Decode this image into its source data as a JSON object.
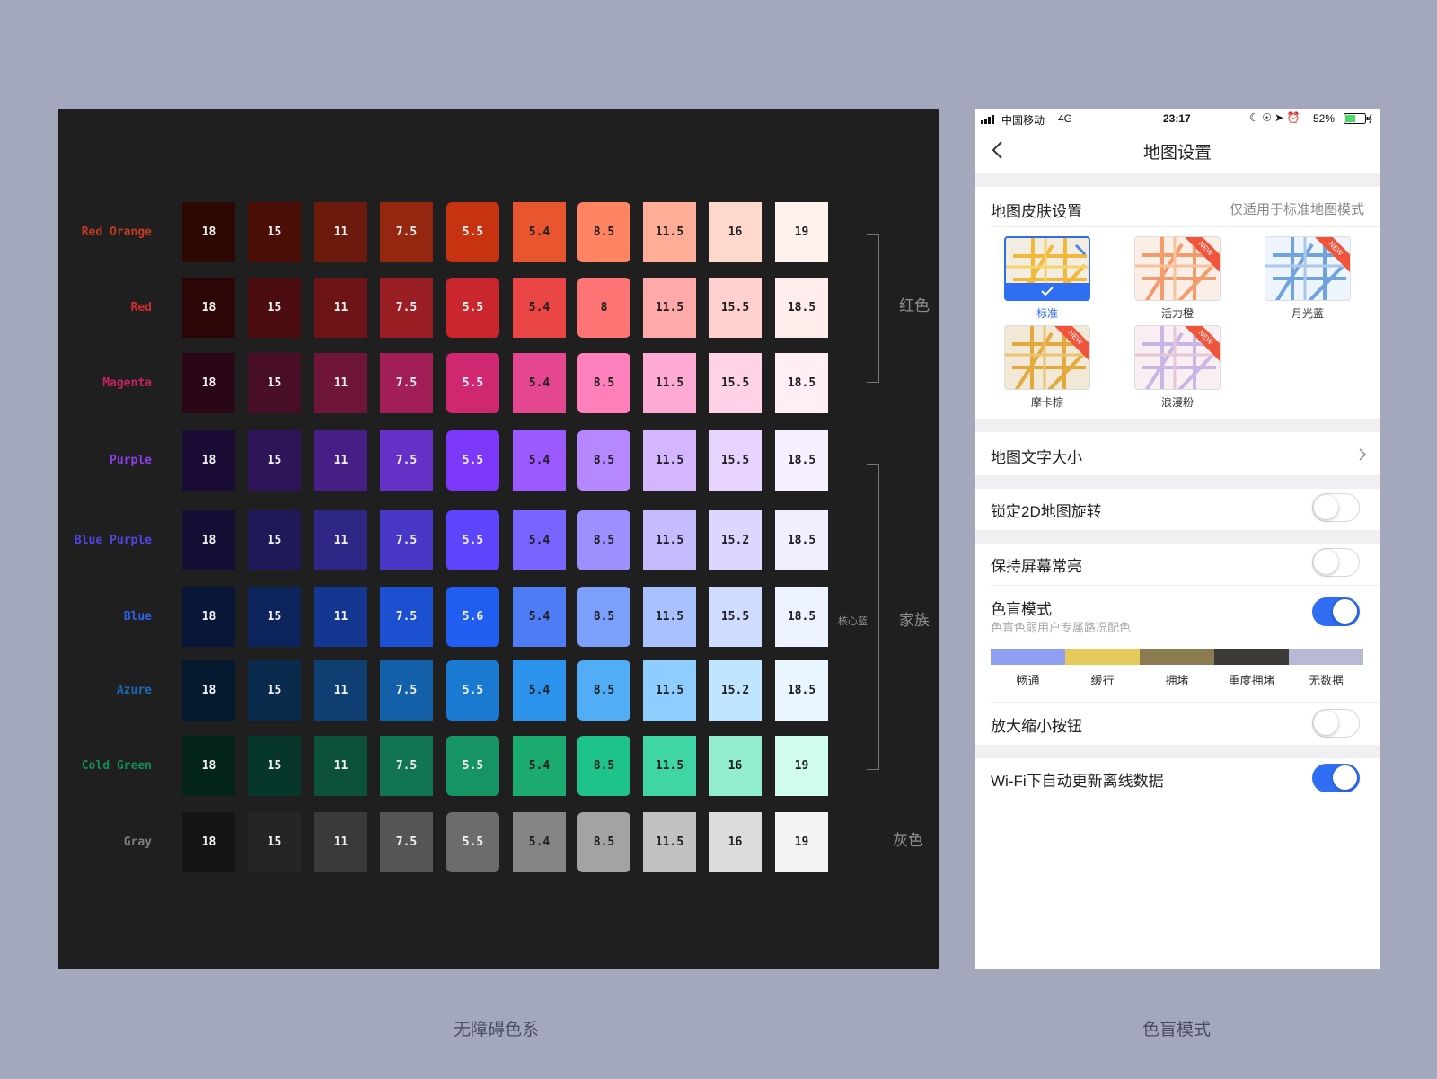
{
  "palette": {
    "rows": [
      {
        "name": "Red Orange",
        "label_color": "#c53a22",
        "values": [
          "18",
          "15",
          "11",
          "7.5",
          "5.5",
          "5.4",
          "8.5",
          "11.5",
          "16",
          "19"
        ],
        "colors": [
          "#2d0803",
          "#4a0f06",
          "#6b1a0c",
          "#95260f",
          "#c73211",
          "#e8552f",
          "#ff8463",
          "#ffad96",
          "#ffd8cd",
          "#fff1ec"
        ]
      },
      {
        "name": "Red",
        "label_color": "#d42b31",
        "values": [
          "18",
          "15",
          "11",
          "7.5",
          "5.5",
          "5.4",
          "8",
          "11.5",
          "15.5",
          "18.5"
        ],
        "colors": [
          "#2d0707",
          "#4b0d0f",
          "#6d1417",
          "#9a1f24",
          "#c9262e",
          "#ea4646",
          "#ff7474",
          "#ffaaa8",
          "#ffd0cd",
          "#ffeceb"
        ]
      },
      {
        "name": "Magenta",
        "label_color": "#c2225e",
        "values": [
          "18",
          "15",
          "11",
          "7.5",
          "5.5",
          "5.4",
          "8.5",
          "11.5",
          "15.5",
          "18.5"
        ],
        "colors": [
          "#2a0716",
          "#480d27",
          "#6e1539",
          "#a11f56",
          "#cf2871",
          "#e44790",
          "#ff80bb",
          "#ffaad5",
          "#ffd2e8",
          "#ffeef6"
        ]
      },
      {
        "name": "Purple",
        "label_color": "#8a3ee8",
        "values": [
          "18",
          "15",
          "11",
          "7.5",
          "5.5",
          "5.4",
          "8.5",
          "11.5",
          "15.5",
          "18.5"
        ],
        "colors": [
          "#1b0c35",
          "#2d1558",
          "#451f85",
          "#6530c6",
          "#7b38f8",
          "#9b59ff",
          "#b588ff",
          "#d4b5ff",
          "#e6d4ff",
          "#f6efff"
        ]
      },
      {
        "name": "Blue Purple",
        "label_color": "#5645e6",
        "values": [
          "18",
          "15",
          "11",
          "7.5",
          "5.5",
          "5.4",
          "8.5",
          "11.5",
          "15.2",
          "18.5"
        ],
        "colors": [
          "#130f35",
          "#1f1958",
          "#2f2785",
          "#4938c8",
          "#5d45fb",
          "#7864ff",
          "#9d8fff",
          "#c4bcff",
          "#ddd7ff",
          "#f1eeff"
        ]
      },
      {
        "name": "Blue",
        "label_color": "#2f5fe6",
        "values": [
          "18",
          "15",
          "11",
          "7.5",
          "5.6",
          "5.4",
          "8.5",
          "11.5",
          "15.5",
          "18.5"
        ],
        "colors": [
          "#081638",
          "#0d235c",
          "#143590",
          "#1d4fd1",
          "#1f5ef0",
          "#4d7cf5",
          "#7c9ffb",
          "#a9c1ff",
          "#cfdcff",
          "#ecf2ff"
        ]
      },
      {
        "name": "Azure",
        "label_color": "#1b69b8",
        "values": [
          "18",
          "15",
          "11",
          "7.5",
          "5.5",
          "5.4",
          "8.5",
          "11.5",
          "15.2",
          "18.5"
        ],
        "colors": [
          "#051a2e",
          "#0a2a4c",
          "#0f3f72",
          "#1460a8",
          "#1a79d1",
          "#2b93ec",
          "#51adf6",
          "#8dceff",
          "#c0e5ff",
          "#e9f6ff"
        ]
      },
      {
        "name": "Cold Green",
        "label_color": "#148a58",
        "values": [
          "18",
          "15",
          "11",
          "7.5",
          "5.5",
          "5.4",
          "8.5",
          "11.5",
          "16",
          "19"
        ],
        "colors": [
          "#04231a",
          "#07372a",
          "#0c5239",
          "#127551",
          "#169463",
          "#1cab70",
          "#1dc389",
          "#40d5a5",
          "#92ecd0",
          "#d0fcee"
        ]
      },
      {
        "name": "Gray",
        "label_color": "#7d7d7d",
        "values": [
          "18",
          "15",
          "11",
          "7.5",
          "5.5",
          "5.4",
          "8.5",
          "11.5",
          "16",
          "19"
        ],
        "colors": [
          "#151515",
          "#252525",
          "#3a3a3a",
          "#555555",
          "#6c6c6c",
          "#858585",
          "#a3a3a3",
          "#c2c2c2",
          "#dcdcdc",
          "#f3f3f3"
        ]
      }
    ],
    "groups": {
      "red": "红色",
      "family": "家族",
      "core": "核心蓝",
      "gray": "灰色"
    }
  },
  "phone": {
    "status": {
      "carrier": "中国移动",
      "network": "4G",
      "time": "23:17",
      "battery": "52%"
    },
    "nav_title": "地图设置",
    "skin": {
      "title": "地图皮肤设置",
      "hint": "仅适用于标准地图模式",
      "new_badge": "NEW",
      "options": [
        "标准",
        "活力橙",
        "月光蓝",
        "摩卡棕",
        "浪漫粉"
      ]
    },
    "text_size": "地图文字大小",
    "lock_2d": "锁定2D地图旋转",
    "screen_on": "保持屏幕常亮",
    "colorblind": {
      "title": "色盲模式",
      "subtitle": "色盲色弱用户专属路况配色",
      "legend": [
        {
          "label": "畅通",
          "color": "#8e9ef0"
        },
        {
          "label": "缓行",
          "color": "#e5c95a"
        },
        {
          "label": "拥堵",
          "color": "#8a7c50"
        },
        {
          "label": "重度拥堵",
          "color": "#3b3a36"
        },
        {
          "label": "无数据",
          "color": "#b6bad6"
        }
      ]
    },
    "zoom_buttons": "放大缩小按钮",
    "wifi_update": "Wi-Fi下自动更新离线数据",
    "accent_color": "#2f6ef2"
  },
  "captions": {
    "left": "无障碍色系",
    "right": "色盲模式"
  }
}
